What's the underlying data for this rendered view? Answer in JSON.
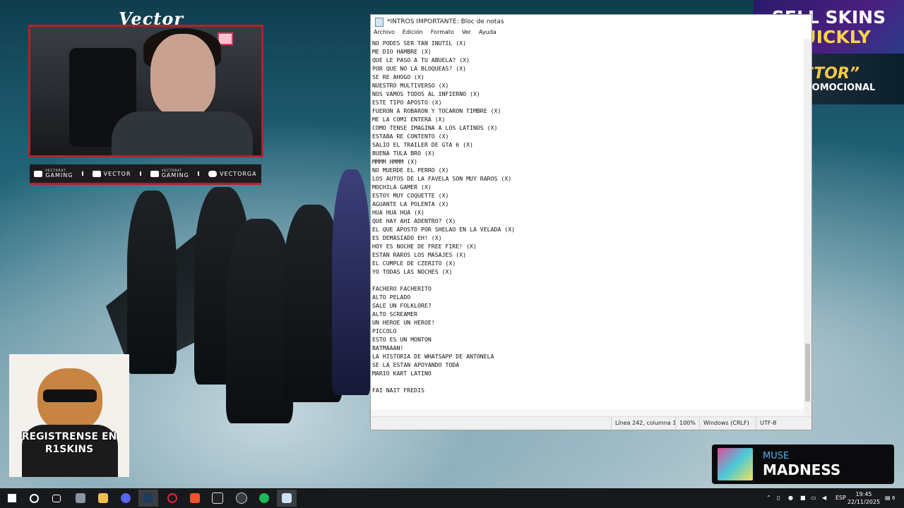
{
  "overlay": {
    "streamer_title": "Vector",
    "social": [
      {
        "icon": "youtube-icon",
        "handle": "VECTORAT",
        "sub": "GAMING"
      },
      {
        "icon": "twitch-icon",
        "handle": "VECTOR",
        "sub": ""
      },
      {
        "icon": "twitter-icon",
        "handle": "VECTORAT",
        "sub": "GAMING"
      },
      {
        "icon": "instagram-icon",
        "handle": "VECTORGA",
        "sub": ""
      }
    ],
    "ad_top": {
      "line1": "SELL SKINS",
      "line2": "QUICKLY"
    },
    "ad_promo": {
      "line1": "“VECTOR”",
      "line2": "CODIGO PROMOCIONAL"
    },
    "cat_banner": {
      "line1": "REGISTRENSE EN",
      "line2": "R1SKINS"
    },
    "now_playing": {
      "artist": "MUSE",
      "song": "MADNESS"
    }
  },
  "notepad": {
    "title": "*INTROS IMPORTANTE: Bloc de notas",
    "menu": [
      "Archivo",
      "Edición",
      "Formato",
      "Ver",
      "Ayuda"
    ],
    "content": "NO PODES SER TAN INUTIL (X)\nME DIO HAMBRE (X)\nQUE LE PASO A TU ABUELA? (X)\nPOR QUE NO LA BLOQUEAS? (X)\nSE RE AHOGO (X)\nNUESTRO MULTIVERSO (X)\nNOS VAMOS TODOS AL INFIERNO (X)\nESTE TIPO APOSTO (X)\nFUERON A ROBARON Y TOCARON TIMBRE (X)\nME LA COMI ENTERA (X)\nCOMO TENSE IMAGINA A LOS LATINOS (X)\nESTABA RE CONTENTO (X)\nSALIO EL TRAILER DE GTA 6 (X)\nBUENA TULA BRO (X)\nMMMM HMMM (X)\nNO MUERDE EL PERRO (X)\nLOS AUTOS DE LA FAVELA SON MUY RAROS (X)\nMOCHILA GAMER (X)\nESTOY MUY COQUETTE (X)\nAGUANTE LA POLENTA (X)\nHUA HUA HUA (X)\nQUE HAY AHI ADENTRO? (X)\nEL QUE APOSTO POR SHELAO EN LA VELADA (X)\nES DEMASIADO EH! (X)\nHOY ES NOCHE DE FREE FIRE! (X)\nESTAN RAROS LOS MASAJES (X)\nEL CUMPLE DE CZERITO (X)\nYO TODAS LAS NOCHES (X)\n\nFACHERO FACHERITO\nALTO PELADO\nSALE UN FOLKLORE?\nALTO SCREAMER\nUN HEROE UN HEROE!\nPICCOLO\nESTO ES UN MONTON\nBATMAAAN!\nLA HISTORIA DE WHATSAPP DE ANTONELA\nSE LA ESTAN APOYANDO TODA\nMARIO KART LATINO\n\nFAI NAIT FREDIS",
    "status": {
      "position": "Línea 242, columna 1",
      "zoom": "100%",
      "line_ending": "Windows (CRLF)",
      "encoding": "UTF-8"
    }
  },
  "taskbar": {
    "apps": [
      "windows-start-icon",
      "search-icon",
      "task-view-icon",
      "file-manager-icon",
      "file-explorer-icon",
      "discord-icon",
      "steam-icon",
      "opera-gx-icon",
      "brave-icon",
      "epic-games-icon",
      "obs-icon",
      "spotify-icon",
      "notepad-icon"
    ],
    "active_app": "notepad-icon",
    "language": "ESP",
    "time": "19:45",
    "date": "22/11/2025",
    "notification_count": "6"
  },
  "colors": {
    "overlay_red": "#b0222a",
    "promo_gold": "#f6c84a",
    "skins_yellow": "#f7d34a",
    "artist_blue": "#4fb0e8"
  }
}
